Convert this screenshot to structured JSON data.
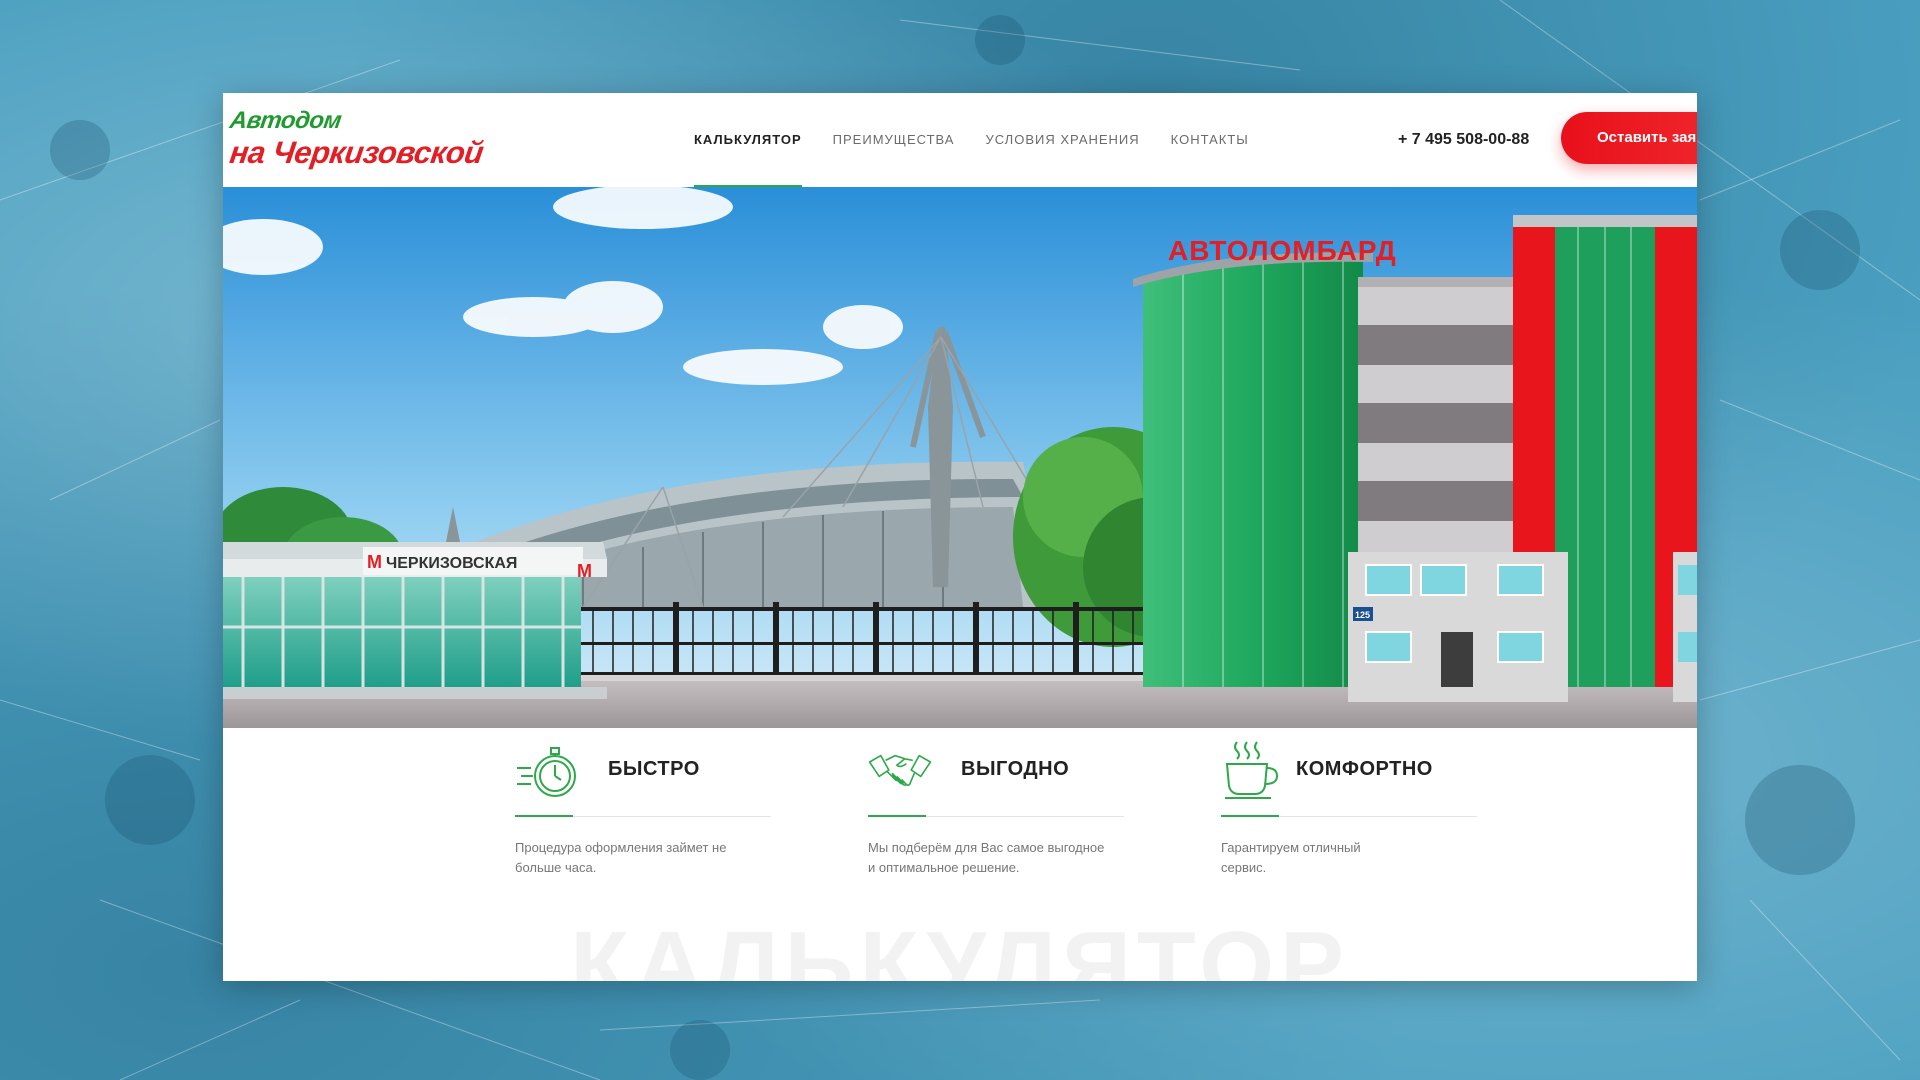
{
  "header": {
    "logo": {
      "line1": "Автодом",
      "line2": "на Черкизовской"
    },
    "nav": [
      {
        "label": "КАЛЬКУЛЯТОР",
        "active": true
      },
      {
        "label": "ПРЕИМУЩЕСТВА",
        "active": false
      },
      {
        "label": "УСЛОВИЯ ХРАНЕНИЯ",
        "active": false
      },
      {
        "label": "КОНТАКТЫ",
        "active": false
      }
    ],
    "phone": "+ 7 495 508-00-88",
    "cta_label": "Оставить заявку"
  },
  "hero": {
    "station_sign": "ЧЕРКИЗОВСКАЯ",
    "metro_letter": "М",
    "building_sign": "АВТОЛОМБАРД",
    "house_number": "125"
  },
  "features": [
    {
      "icon": "stopwatch-icon",
      "title": "БЫСТРО",
      "text": "Процедура оформления займет не больше часа."
    },
    {
      "icon": "handshake-icon",
      "title": "ВЫГОДНО",
      "text": "Мы подберём для Вас самое выгодное и оптимальное решение."
    },
    {
      "icon": "coffee-cup-icon",
      "title": "КОМФОРТНО",
      "text": "Гарантируем отличный сервис."
    }
  ],
  "section_title_ghost": "КАЛЬКУЛЯТОР",
  "colors": {
    "accent_green": "#2ea84a",
    "accent_red": "#e31e24",
    "background": "#4a9fc0"
  }
}
